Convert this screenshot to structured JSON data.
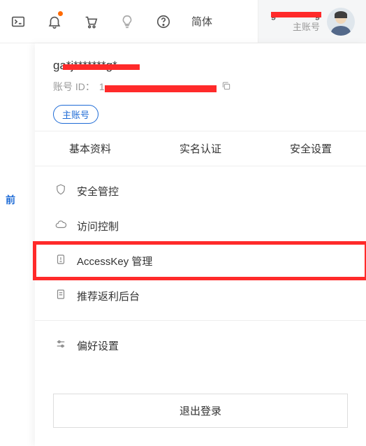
{
  "topbar": {
    "lang": "简体",
    "account_name": "g***********g",
    "account_sub": "主账号"
  },
  "panel": {
    "username": "ga*j*******g*",
    "account_id_label": "账号 ID：",
    "account_id_prefix": "1",
    "account_id_masked": "****************",
    "badge": "主账号"
  },
  "tabs": [
    {
      "label": "基本资料"
    },
    {
      "label": "实名认证"
    },
    {
      "label": "安全设置"
    }
  ],
  "menu": [
    {
      "label": "安全管控",
      "icon": "shield-icon"
    },
    {
      "label": "访问控制",
      "icon": "cloud-icon"
    },
    {
      "label": "AccessKey 管理",
      "icon": "key-icon",
      "highlight": true
    },
    {
      "label": "推荐返利后台",
      "icon": "doc-icon"
    }
  ],
  "preferences": {
    "label": "偏好设置"
  },
  "logout": {
    "label": "退出登录"
  },
  "background_hint": {
    "suffix": "。",
    "link": "前"
  }
}
